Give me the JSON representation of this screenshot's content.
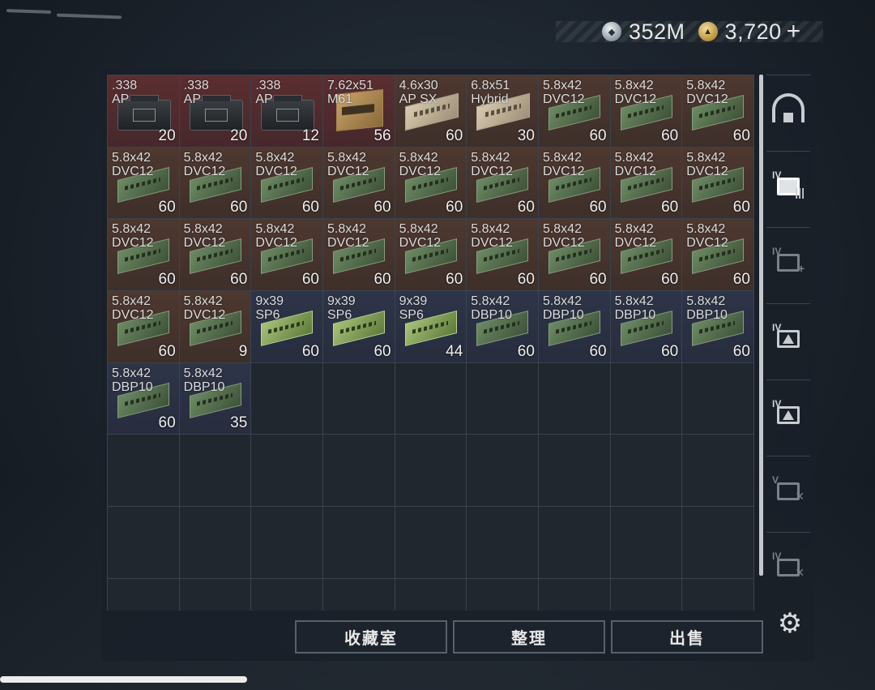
{
  "currency": {
    "silver_icon": "silver-coin-icon",
    "silver_amount": "352M",
    "gold_icon": "gold-coin-icon",
    "gold_amount": "3,720",
    "plus": "+"
  },
  "stash": {
    "rows": [
      [
        {
          "name": ".338\nAP",
          "count": "20",
          "tier": "red",
          "art": "ammocan"
        },
        {
          "name": ".338\nAP",
          "count": "20",
          "tier": "red",
          "art": "ammocan"
        },
        {
          "name": ".338\nAP",
          "count": "12",
          "tier": "red",
          "art": "ammocan"
        },
        {
          "name": "7.62x51\nM61",
          "count": "56",
          "tier": "red",
          "art": "cardbox"
        },
        {
          "name": "4.6x30\nAP SX",
          "count": "60",
          "tier": "orange",
          "art": "tanbox"
        },
        {
          "name": "6.8x51\nHybrid",
          "count": "30",
          "tier": "orange",
          "art": "tanbox"
        },
        {
          "name": "5.8x42\nDVC12",
          "count": "60",
          "tier": "orange",
          "art": "greenbox"
        },
        {
          "name": "5.8x42\nDVC12",
          "count": "60",
          "tier": "orange",
          "art": "greenbox"
        },
        {
          "name": "5.8x42\nDVC12",
          "count": "60",
          "tier": "orange",
          "art": "greenbox"
        }
      ],
      [
        {
          "name": "5.8x42\nDVC12",
          "count": "60",
          "tier": "orange",
          "art": "greenbox"
        },
        {
          "name": "5.8x42\nDVC12",
          "count": "60",
          "tier": "orange",
          "art": "greenbox"
        },
        {
          "name": "5.8x42\nDVC12",
          "count": "60",
          "tier": "orange",
          "art": "greenbox"
        },
        {
          "name": "5.8x42\nDVC12",
          "count": "60",
          "tier": "orange",
          "art": "greenbox"
        },
        {
          "name": "5.8x42\nDVC12",
          "count": "60",
          "tier": "orange",
          "art": "greenbox"
        },
        {
          "name": "5.8x42\nDVC12",
          "count": "60",
          "tier": "orange",
          "art": "greenbox"
        },
        {
          "name": "5.8x42\nDVC12",
          "count": "60",
          "tier": "orange",
          "art": "greenbox"
        },
        {
          "name": "5.8x42\nDVC12",
          "count": "60",
          "tier": "orange",
          "art": "greenbox"
        },
        {
          "name": "5.8x42\nDVC12",
          "count": "60",
          "tier": "orange",
          "art": "greenbox"
        }
      ],
      [
        {
          "name": "5.8x42\nDVC12",
          "count": "60",
          "tier": "orange",
          "art": "greenbox"
        },
        {
          "name": "5.8x42\nDVC12",
          "count": "60",
          "tier": "orange",
          "art": "greenbox"
        },
        {
          "name": "5.8x42\nDVC12",
          "count": "60",
          "tier": "orange",
          "art": "greenbox"
        },
        {
          "name": "5.8x42\nDVC12",
          "count": "60",
          "tier": "orange",
          "art": "greenbox"
        },
        {
          "name": "5.8x42\nDVC12",
          "count": "60",
          "tier": "orange",
          "art": "greenbox"
        },
        {
          "name": "5.8x42\nDVC12",
          "count": "60",
          "tier": "orange",
          "art": "greenbox"
        },
        {
          "name": "5.8x42\nDVC12",
          "count": "60",
          "tier": "orange",
          "art": "greenbox"
        },
        {
          "name": "5.8x42\nDVC12",
          "count": "60",
          "tier": "orange",
          "art": "greenbox"
        },
        {
          "name": "5.8x42\nDVC12",
          "count": "60",
          "tier": "orange",
          "art": "greenbox"
        }
      ],
      [
        {
          "name": "5.8x42\nDVC12",
          "count": "60",
          "tier": "orange",
          "art": "greenbox"
        },
        {
          "name": "5.8x42\nDVC12",
          "count": "9",
          "tier": "orange",
          "art": "greenbox"
        },
        {
          "name": "9x39\nSP6",
          "count": "60",
          "tier": "blue",
          "art": "limebox"
        },
        {
          "name": "9x39\nSP6",
          "count": "60",
          "tier": "blue",
          "art": "limebox"
        },
        {
          "name": "9x39\nSP6",
          "count": "44",
          "tier": "blue",
          "art": "limebox"
        },
        {
          "name": "5.8x42\nDBP10",
          "count": "60",
          "tier": "blue",
          "art": "greenbox"
        },
        {
          "name": "5.8x42\nDBP10",
          "count": "60",
          "tier": "blue",
          "art": "greenbox"
        },
        {
          "name": "5.8x42\nDBP10",
          "count": "60",
          "tier": "blue",
          "art": "greenbox"
        },
        {
          "name": "5.8x42\nDBP10",
          "count": "60",
          "tier": "blue",
          "art": "greenbox"
        }
      ],
      [
        {
          "name": "5.8x42\nDBP10",
          "count": "60",
          "tier": "blue",
          "art": "greenbox"
        },
        {
          "name": "5.8x42\nDBP10",
          "count": "35",
          "tier": "blue",
          "art": "greenbox"
        }
      ]
    ],
    "total_rows": 8,
    "columns": 9
  },
  "sidebar": [
    {
      "name": "sidebar-home-button",
      "icon": "stash-home-icon",
      "tier": "",
      "state": "normal"
    },
    {
      "name": "sidebar-folder-iv-button",
      "icon": "folder-iv-icon",
      "tier": "IV",
      "state": "active"
    },
    {
      "name": "sidebar-med-iv-button",
      "icon": "medkit-iv-icon",
      "tier": "IV",
      "state": "dim"
    },
    {
      "name": "sidebar-warning-iv-button",
      "icon": "container-warning-iv-icon",
      "tier": "IV",
      "state": "normal"
    },
    {
      "name": "sidebar-container-iv-button",
      "icon": "container-iv-icon",
      "tier": "IV",
      "state": "normal"
    },
    {
      "name": "sidebar-tools-v-button",
      "icon": "toolbox-v-icon",
      "tier": "V",
      "state": "dim"
    },
    {
      "name": "sidebar-tools-iv-button",
      "icon": "toolbox-iv-icon",
      "tier": "IV",
      "state": "dim"
    }
  ],
  "settings_icon": "gear-icon",
  "buttons": {
    "collection": "收藏室",
    "organize": "整理",
    "sell": "出售"
  }
}
